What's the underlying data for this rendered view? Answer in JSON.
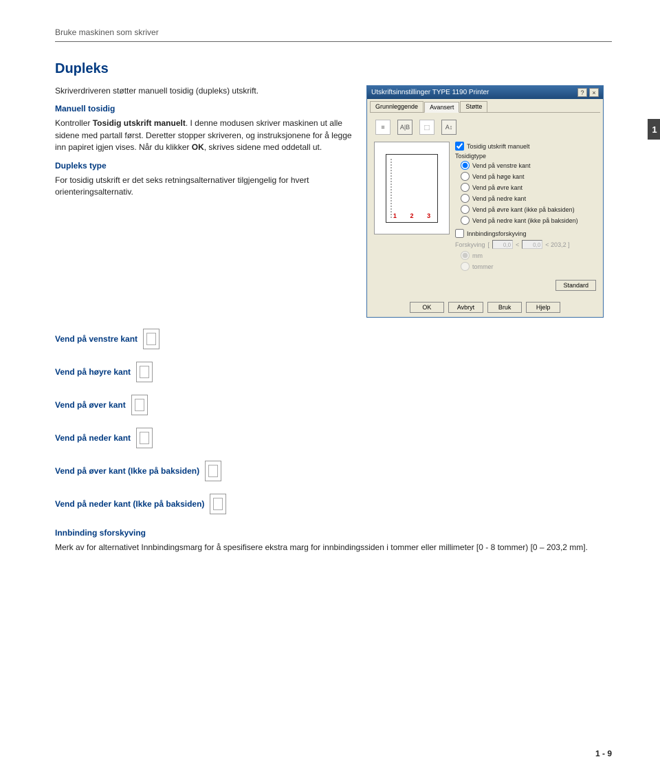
{
  "header": "Bruke maskinen som skriver",
  "main_heading": "Dupleks",
  "intro_text": "Skriverdriveren støtter manuell tosidig (dupleks) utskrift.",
  "manual_heading": "Manuell tosidig",
  "manual_text_1": "Kontroller ",
  "manual_text_bold_1": "Tosidig utskrift manuelt",
  "manual_text_2": ". I denne modusen skriver maskinen ut alle sidene med partall først. Deretter stopper skriveren, og instruksjonene for å legge inn papiret igjen vises. Når du klikker ",
  "manual_text_bold_2": "OK",
  "manual_text_3": ", skrives sidene med oddetall ut.",
  "type_heading": "Dupleks type",
  "type_text": "For tosidig utskrift er det seks retningsalternativer tilgjengelig for hvert orienteringsalternativ.",
  "vend_options": [
    "Vend på venstre kant",
    "Vend på høyre kant",
    "Vend på øver kant",
    "Vend på neder kant",
    "Vend på øver kant (Ikke på baksiden)",
    "Vend på neder kant (Ikke på baksiden)"
  ],
  "binding_heading": "Innbinding sforskyving",
  "binding_text": "Merk av for alternativet Innbindingsmarg for å spesifisere ekstra marg for innbindingssiden i tommer eller millimeter [0 - 8 tommer) [0 – 203,2 mm].",
  "chapter_tab": "1",
  "page_number": "1 - 9",
  "dialog": {
    "title": "Utskriftsinnstillinger TYPE 1190 Printer",
    "close_help": "?",
    "close_x": "×",
    "tabs": [
      "Grunnleggende",
      "Avansert",
      "Støtte"
    ],
    "active_tab": 1,
    "icon_labels": [
      "≡",
      "A|B",
      "⬚",
      "A↕"
    ],
    "preview_nums": [
      "1",
      "2",
      "3"
    ],
    "chk_manual": "Tosidig utskrift manuelt",
    "group_label": "Tosidigtype",
    "radios": [
      "Vend på venstre kant",
      "Vend på høge kant",
      "Vend på øvre kant",
      "Vend på nedre kant",
      "Vend på øvre kant (ikke på baksiden)",
      "Vend på nedre kant (ikke på baksiden)"
    ],
    "selected_radio": 0,
    "chk_binding": "Innbindingsforskyving",
    "binding_label": "Forskyving",
    "binding_val1": "0,0",
    "binding_val2": "0,0",
    "binding_range": "< 203,2  ]",
    "unit_mm": "mm",
    "unit_tommer": "tommer",
    "btn_standard": "Standard",
    "btn_ok": "OK",
    "btn_avbryt": "Avbryt",
    "btn_bruk": "Bruk",
    "btn_hjelp": "Hjelp"
  }
}
